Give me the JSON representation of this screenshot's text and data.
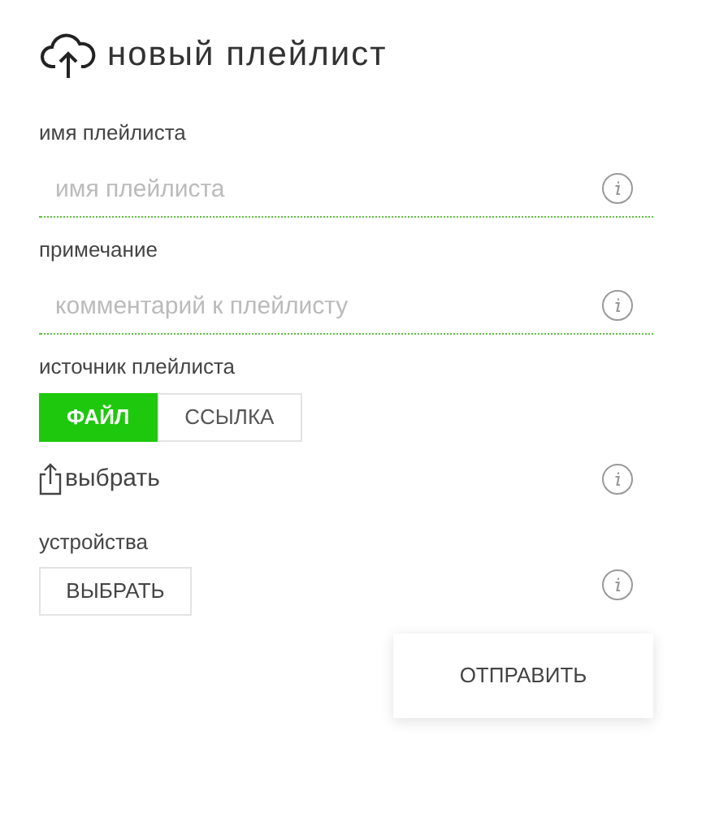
{
  "title": "новый плейлист",
  "fields": [
    {
      "label": "имя плейлиста",
      "placeholder": "имя плейлиста"
    },
    {
      "label": "примечание",
      "placeholder": "комментарий к плейлисту"
    }
  ],
  "source": {
    "label": "источник плейлиста",
    "options": [
      {
        "label": "ФАЙЛ",
        "selected": true
      },
      {
        "label": "ССЫЛКА",
        "selected": false
      }
    ],
    "pick": "выбрать"
  },
  "devices": {
    "label": "устройства",
    "button": "ВЫБРАТЬ"
  },
  "submit": "ОТПРАВИТЬ"
}
